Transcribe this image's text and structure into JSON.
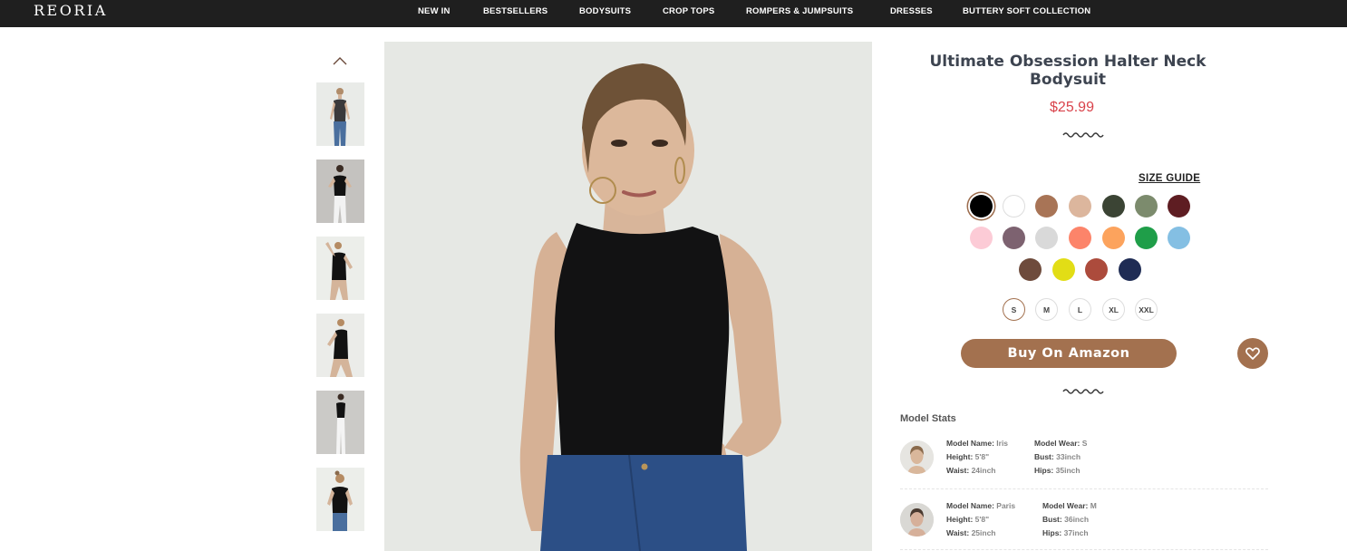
{
  "brand": {
    "logo": "REORIA"
  },
  "nav": {
    "items": [
      "NEW IN",
      "BESTSELLERS",
      "BODYSUITS",
      "CROP TOPS",
      "ROMPERS & JUMPSUITS",
      "DRESSES",
      "BUTTERY SOFT COLLECTION"
    ]
  },
  "product": {
    "title": "Ultimate Obsession Halter Neck Bodysuit",
    "price": "$25.99",
    "size_guide": "SIZE GUIDE",
    "colors": [
      "#000000",
      "#ffffff",
      "#a87456",
      "#dcb69d",
      "#3b4434",
      "#7c8b6d",
      "#5e1d22",
      "#fccbd6",
      "#7d6270",
      "#d9d9d9",
      "#fc846a",
      "#fca35d",
      "#1f9e49",
      "#84bfe3",
      "#6e4b3c",
      "#e2dd16",
      "#ac4b3c",
      "#1f2c54"
    ],
    "selected_color": "#000000",
    "sizes": [
      "S",
      "M",
      "L",
      "XL",
      "XXL"
    ],
    "selected_size": "S",
    "buy_label": "Buy On Amazon"
  },
  "model_stats": {
    "title": "Model Stats",
    "models": [
      {
        "name_label": "Model Name:",
        "name": "Iris",
        "height_label": "Height:",
        "height": "5'8\"",
        "waist_label": "Waist:",
        "waist": "24inch",
        "wear_label": "Model Wear:",
        "wear": "S",
        "bust_label": "Bust:",
        "bust": "33inch",
        "hips_label": "Hips:",
        "hips": "35inch"
      },
      {
        "name_label": "Model Name:",
        "name": "Paris",
        "height_label": "Height:",
        "height": "5'8\"",
        "waist_label": "Waist:",
        "waist": "25inch",
        "wear_label": "Model Wear:",
        "wear": "M",
        "bust_label": "Bust:",
        "bust": "36inch",
        "hips_label": "Hips:",
        "hips": "37inch"
      }
    ]
  }
}
